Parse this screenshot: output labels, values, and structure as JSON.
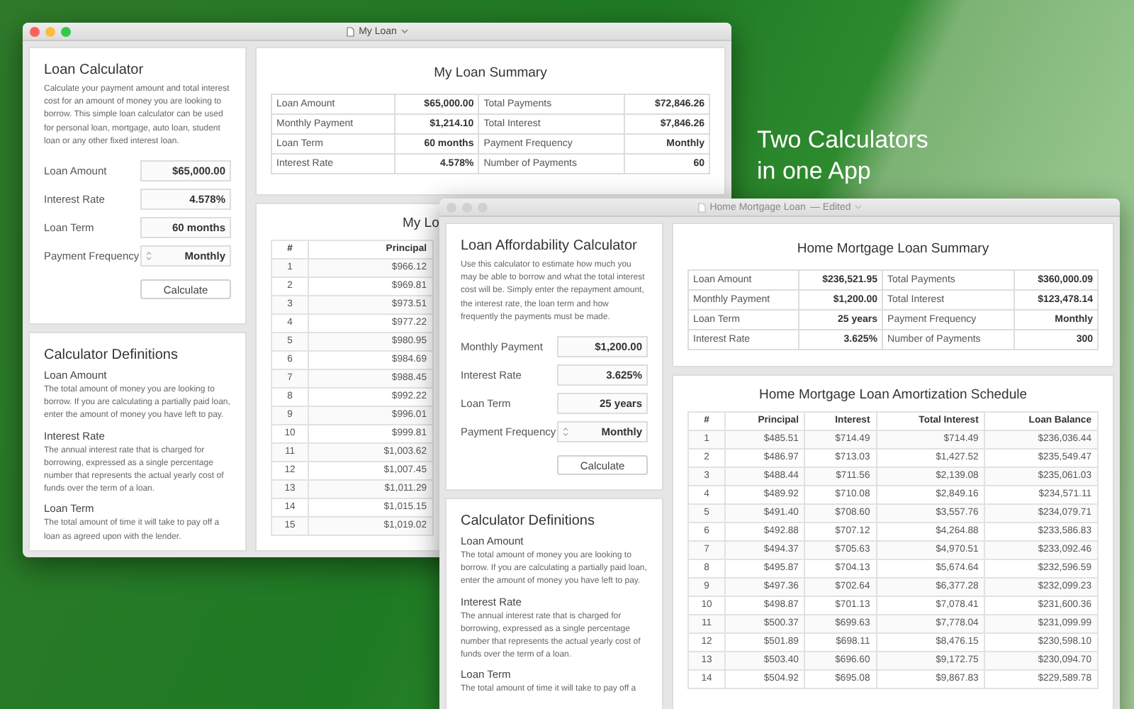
{
  "windows": [
    {
      "title": "My Loan",
      "active": true,
      "calculator": {
        "title": "Loan Calculator",
        "description": "Calculate your payment amount and total interest cost for an amount of money you are looking to borrow. This simple loan calculator can be used for personal loan, mortgage, auto loan, student loan or any other fixed interest loan.",
        "fields": [
          {
            "label": "Loan Amount",
            "value": "$65,000.00",
            "kind": "text"
          },
          {
            "label": "Interest Rate",
            "value": "4.578%",
            "kind": "text"
          },
          {
            "label": "Loan Term",
            "value": "60 months",
            "kind": "text"
          },
          {
            "label": "Payment Frequency",
            "value": "Monthly",
            "kind": "popup"
          }
        ],
        "button": "Calculate"
      },
      "definitions": {
        "title": "Calculator Definitions",
        "items": [
          {
            "term": "Loan Amount",
            "text": "The total amount of money you are looking to borrow. If you are calculating a partially paid loan, enter the amount of money you have left to pay."
          },
          {
            "term": "Interest Rate",
            "text": "The annual interest rate that is charged for borrowing, expressed as a single percentage number that represents the actual yearly cost of funds over the term of a loan."
          },
          {
            "term": "Loan Term",
            "text": "The total amount of time it will take to pay off a loan as agreed upon with the lender."
          }
        ]
      },
      "summary": {
        "title": "My Loan Summary",
        "rows": [
          [
            "Loan Amount",
            "$65,000.00",
            "Total Payments",
            "$72,846.26"
          ],
          [
            "Monthly Payment",
            "$1,214.10",
            "Total Interest",
            "$7,846.26"
          ],
          [
            "Loan Term",
            "60 months",
            "Payment Frequency",
            "Monthly"
          ],
          [
            "Interest Rate",
            "4.578%",
            "Number of Payments",
            "60"
          ]
        ]
      },
      "schedule": {
        "title": "My Lo",
        "columns": [
          "#",
          "Principal"
        ],
        "rows": [
          [
            "1",
            "$966.12"
          ],
          [
            "2",
            "$969.81"
          ],
          [
            "3",
            "$973.51"
          ],
          [
            "4",
            "$977.22"
          ],
          [
            "5",
            "$980.95"
          ],
          [
            "6",
            "$984.69"
          ],
          [
            "7",
            "$988.45"
          ],
          [
            "8",
            "$992.22"
          ],
          [
            "9",
            "$996.01"
          ],
          [
            "10",
            "$999.81"
          ],
          [
            "11",
            "$1,003.62"
          ],
          [
            "12",
            "$1,007.45"
          ],
          [
            "13",
            "$1,011.29"
          ],
          [
            "14",
            "$1,015.15"
          ],
          [
            "15",
            "$1,019.02"
          ]
        ]
      }
    },
    {
      "title": "Home Mortgage Loan",
      "status": "— Edited",
      "active": false,
      "calculator": {
        "title": "Loan Affordability Calculator",
        "description": "Use this calculator to estimate how much you may be able to borrow and what the total interest cost will be. Simply enter the repayment amount, the interest rate, the loan term and how frequently the payments must be made.",
        "fields": [
          {
            "label": "Monthly Payment",
            "value": "$1,200.00",
            "kind": "text"
          },
          {
            "label": "Interest Rate",
            "value": "3.625%",
            "kind": "text"
          },
          {
            "label": "Loan Term",
            "value": "25 years",
            "kind": "text"
          },
          {
            "label": "Payment Frequency",
            "value": "Monthly",
            "kind": "popup"
          }
        ],
        "button": "Calculate"
      },
      "definitions": {
        "title": "Calculator Definitions",
        "items": [
          {
            "term": "Loan Amount",
            "text": "The total amount of money you are looking to borrow. If you are calculating a partially paid loan, enter the amount of money you have left to pay."
          },
          {
            "term": "Interest Rate",
            "text": "The annual interest rate that is charged for borrowing, expressed as a single percentage number that represents the actual yearly cost of funds over the term of a loan."
          },
          {
            "term": "Loan Term",
            "text": "The total amount of time it will take to pay off a"
          }
        ]
      },
      "summary": {
        "title": "Home Mortgage Loan Summary",
        "rows": [
          [
            "Loan Amount",
            "$236,521.95",
            "Total Payments",
            "$360,000.09"
          ],
          [
            "Monthly Payment",
            "$1,200.00",
            "Total Interest",
            "$123,478.14"
          ],
          [
            "Loan Term",
            "25 years",
            "Payment Frequency",
            "Monthly"
          ],
          [
            "Interest Rate",
            "3.625%",
            "Number of Payments",
            "300"
          ]
        ]
      },
      "schedule": {
        "title": "Home Mortgage Loan Amortization Schedule",
        "columns": [
          "#",
          "Principal",
          "Interest",
          "Total Interest",
          "Loan Balance"
        ],
        "rows": [
          [
            "1",
            "$485.51",
            "$714.49",
            "$714.49",
            "$236,036.44"
          ],
          [
            "2",
            "$486.97",
            "$713.03",
            "$1,427.52",
            "$235,549.47"
          ],
          [
            "3",
            "$488.44",
            "$711.56",
            "$2,139.08",
            "$235,061.03"
          ],
          [
            "4",
            "$489.92",
            "$710.08",
            "$2,849.16",
            "$234,571.11"
          ],
          [
            "5",
            "$491.40",
            "$708.60",
            "$3,557.76",
            "$234,079.71"
          ],
          [
            "6",
            "$492.88",
            "$707.12",
            "$4,264.88",
            "$233,586.83"
          ],
          [
            "7",
            "$494.37",
            "$705.63",
            "$4,970.51",
            "$233,092.46"
          ],
          [
            "8",
            "$495.87",
            "$704.13",
            "$5,674.64",
            "$232,596.59"
          ],
          [
            "9",
            "$497.36",
            "$702.64",
            "$6,377.28",
            "$232,099.23"
          ],
          [
            "10",
            "$498.87",
            "$701.13",
            "$7,078.41",
            "$231,600.36"
          ],
          [
            "11",
            "$500.37",
            "$699.63",
            "$7,778.04",
            "$231,099.99"
          ],
          [
            "12",
            "$501.89",
            "$698.11",
            "$8,476.15",
            "$230,598.10"
          ],
          [
            "13",
            "$503.40",
            "$696.60",
            "$9,172.75",
            "$230,094.70"
          ],
          [
            "14",
            "$504.92",
            "$695.08",
            "$9,867.83",
            "$229,589.78"
          ]
        ]
      }
    }
  ],
  "tagline": "Two Calculators in one App"
}
